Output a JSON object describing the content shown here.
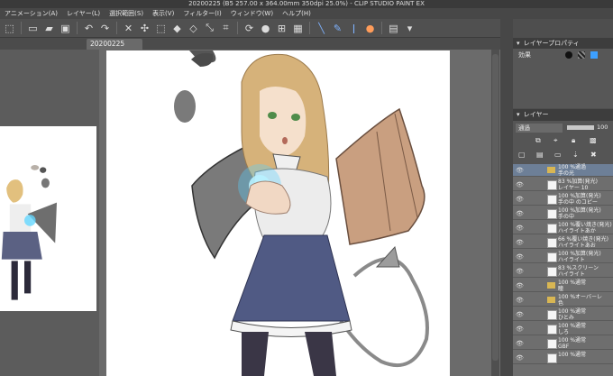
{
  "window": {
    "title": "20200225 (B5 257.00 x 364.00mm 350dpi 25.0%) - CLIP STUDIO PAINT EX"
  },
  "menu": [
    "アニメーション(A)",
    "レイヤー(L)",
    "選択範囲(S)",
    "表示(V)",
    "フィルター(I)",
    "ウィンドウ(W)",
    "ヘルプ(H)"
  ],
  "document": {
    "tab_label": "20200225"
  },
  "properties_panel": {
    "title": "レイヤープロパティ",
    "effect_label": "効果"
  },
  "layer_panel": {
    "title": "レイヤー",
    "blend_mode": "通過",
    "opacity": "100",
    "layers": [
      {
        "name": "100 %通過\n手の光",
        "type": "folder",
        "selected": true
      },
      {
        "name": "83 %加算(発光)\nレイヤー 10",
        "type": "layer"
      },
      {
        "name": "100 %加算(発光)\n手の中 のコピー",
        "type": "layer"
      },
      {
        "name": "100 %加算(発光)\n手の中",
        "type": "layer"
      },
      {
        "name": "100 %覆い焼き(発光)\nハイライトあか",
        "type": "layer"
      },
      {
        "name": "66 %覆い焼き(発光)\nハイライトあお",
        "type": "layer"
      },
      {
        "name": "100 %加算(発光)\nハイライト",
        "type": "layer"
      },
      {
        "name": "83 %スクリーン\nハイライト",
        "type": "layer"
      },
      {
        "name": "100 %通常\n瞳",
        "type": "folder"
      },
      {
        "name": "100 %オーバーレ\n色",
        "type": "folder"
      },
      {
        "name": "100 %通常\nひとみ",
        "type": "layer"
      },
      {
        "name": "100 %通常\nしろ",
        "type": "layer"
      },
      {
        "name": "100 %通常\nGBF",
        "type": "layer"
      },
      {
        "name": "100 %通常",
        "type": "layer"
      }
    ]
  }
}
